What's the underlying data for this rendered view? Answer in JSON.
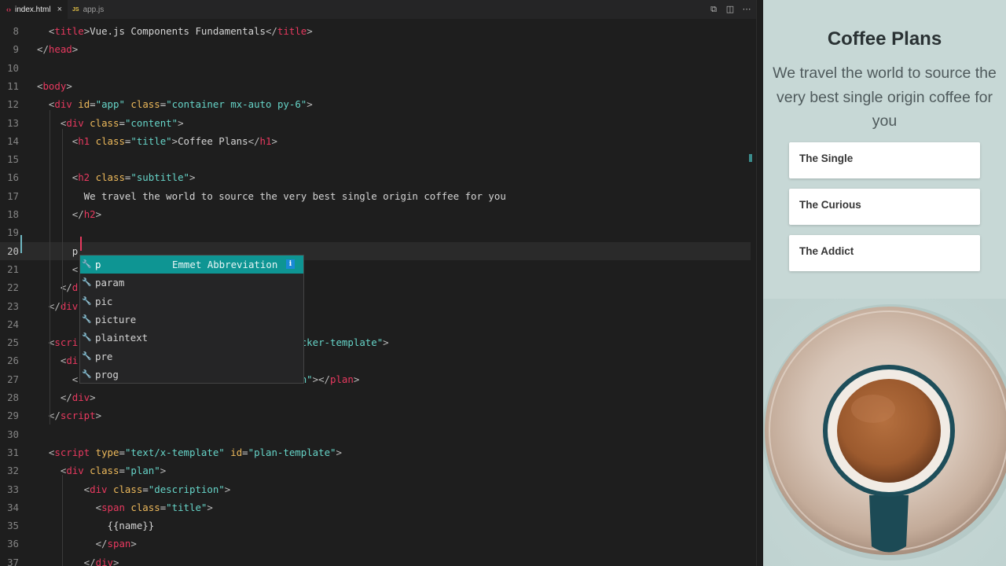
{
  "tabs": [
    {
      "label": "index.html",
      "icon": "‹›",
      "active": true,
      "close": "×"
    },
    {
      "label": "app.js",
      "icon": "JS",
      "active": false
    }
  ],
  "code": {
    "lines": [
      {
        "num": "8",
        "html": "<span class='b'>  &lt;</span><span class='t'>title</span><span class='b'>&gt;</span>Vue.js Components Fundamentals<span class='b'>&lt;/</span><span class='t'>title</span><span class='b'>&gt;</span>"
      },
      {
        "num": "9",
        "html": "<span class='b'>&lt;/</span><span class='t'>head</span><span class='b'>&gt;</span>"
      },
      {
        "num": "10",
        "html": ""
      },
      {
        "num": "11",
        "html": "<span class='b'>&lt;</span><span class='t'>body</span><span class='b'>&gt;</span>"
      },
      {
        "num": "12",
        "html": "<span class='b'>  &lt;</span><span class='t'>div</span> <span class='a'>id</span>=<span class='s'>\"app\"</span> <span class='a'>class</span>=<span class='s'>\"container mx-auto py-6\"</span><span class='b'>&gt;</span>"
      },
      {
        "num": "13",
        "html": "<span class='b'>    &lt;</span><span class='t'>div</span> <span class='a'>class</span>=<span class='s'>\"content\"</span><span class='b'>&gt;</span>"
      },
      {
        "num": "14",
        "html": "<span class='b'>      &lt;</span><span class='t'>h1</span> <span class='a'>class</span>=<span class='s'>\"title\"</span><span class='b'>&gt;</span>Coffee Plans<span class='b'>&lt;/</span><span class='t'>h1</span><span class='b'>&gt;</span>"
      },
      {
        "num": "15",
        "html": ""
      },
      {
        "num": "16",
        "html": "<span class='b'>      &lt;</span><span class='t'>h2</span> <span class='a'>class</span>=<span class='s'>\"subtitle\"</span><span class='b'>&gt;</span>"
      },
      {
        "num": "17",
        "html": "        We travel the world to source the very best single origin coffee for you"
      },
      {
        "num": "18",
        "html": "<span class='b'>      &lt;/</span><span class='t'>h2</span><span class='b'>&gt;</span>"
      },
      {
        "num": "19",
        "html": ""
      },
      {
        "num": "20",
        "html": "      p",
        "current": true
      },
      {
        "num": "21",
        "html": "<span class='b'>      &lt;</span>"
      },
      {
        "num": "22",
        "html": "<span class='b'>    &lt;/</span><span class='t'>d</span>"
      },
      {
        "num": "23",
        "html": "<span class='b'>  &lt;/</span><span class='t'>div</span>"
      },
      {
        "num": "24",
        "html": ""
      },
      {
        "num": "25",
        "html": "<span class='b'>  &lt;</span><span class='t'>scri</span>                                      <span class='s'>cker-template\"</span><span class='b'>&gt;</span>"
      },
      {
        "num": "26",
        "html": "<span class='b'>    &lt;</span><span class='t'>di</span>"
      },
      {
        "num": "27",
        "html": "<span class='b'>      &lt;</span>                                      <span class='s'>n\"</span><span class='b'>&gt;&lt;/</span><span class='t'>plan</span><span class='b'>&gt;</span>"
      },
      {
        "num": "28",
        "html": "<span class='b'>    &lt;/</span><span class='t'>div</span><span class='b'>&gt;</span>"
      },
      {
        "num": "29",
        "html": "<span class='b'>  &lt;/</span><span class='t'>script</span><span class='b'>&gt;</span>"
      },
      {
        "num": "30",
        "html": ""
      },
      {
        "num": "31",
        "html": "<span class='b'>  &lt;</span><span class='t'>script</span> <span class='a'>type</span>=<span class='s'>\"text/x-template\"</span> <span class='a'>id</span>=<span class='s'>\"plan-template\"</span><span class='b'>&gt;</span>"
      },
      {
        "num": "32",
        "html": "<span class='b'>    &lt;</span><span class='t'>div</span> <span class='a'>class</span>=<span class='s'>\"plan\"</span><span class='b'>&gt;</span>"
      },
      {
        "num": "33",
        "html": "<span class='b'>        &lt;</span><span class='t'>div</span> <span class='a'>class</span>=<span class='s'>\"description\"</span><span class='b'>&gt;</span>"
      },
      {
        "num": "34",
        "html": "<span class='b'>          &lt;</span><span class='t'>span</span> <span class='a'>class</span>=<span class='s'>\"title\"</span><span class='b'>&gt;</span>"
      },
      {
        "num": "35",
        "html": "            {{name}}"
      },
      {
        "num": "36",
        "html": "<span class='b'>          &lt;/</span><span class='t'>span</span><span class='b'>&gt;</span>"
      },
      {
        "num": "37",
        "html": "<span class='b'>        &lt;/</span><span class='t'>div</span><span class='b'>&gt;</span>"
      }
    ]
  },
  "suggestions": {
    "items": [
      "p",
      "param",
      "pic",
      "picture",
      "plaintext",
      "pre",
      "prog"
    ],
    "selected_detail": "Emmet Abbreviation",
    "info": "i",
    "icon": "wrench-icon"
  },
  "preview": {
    "title": "Coffee Plans",
    "subtitle": "We travel the world to source the very best single origin coffee for you",
    "plans": [
      "The Single",
      "The Curious",
      "The Addict"
    ]
  },
  "colors": {
    "editor_bg": "#1e1e1e",
    "tag": "#e8395f",
    "attr": "#edb95b",
    "string": "#66d4c8",
    "suggest_selected": "#0e9593",
    "preview_bg": "#c7d8d6"
  }
}
